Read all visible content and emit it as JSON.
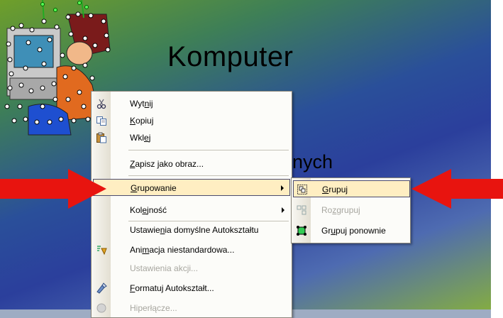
{
  "slide": {
    "title": "Komputer",
    "subtitle_fragment": "nych"
  },
  "context_menu": {
    "items": [
      {
        "pre": "Wyt",
        "ul": "n",
        "post": "ij",
        "icon": "scissors-icon",
        "enabled": true
      },
      {
        "pre": "",
        "ul": "K",
        "post": "opiuj",
        "icon": "copy-icon",
        "enabled": true
      },
      {
        "pre": "Wkl",
        "ul": "e",
        "post": "j",
        "icon": "paste-icon",
        "enabled": true
      },
      {
        "pre": "",
        "ul": "Z",
        "post": "apisz jako obraz...",
        "icon": "",
        "enabled": true
      },
      {
        "pre": "",
        "ul": "G",
        "post": "rupowanie",
        "icon": "",
        "enabled": true,
        "submenu": true,
        "highlighted": true
      },
      {
        "pre": "Kol",
        "ul": "e",
        "post": "jność",
        "icon": "",
        "enabled": true,
        "submenu": true
      },
      {
        "pre": "Ustawie",
        "ul": "n",
        "post": "ia domyślne Autokształtu",
        "icon": "",
        "enabled": true
      },
      {
        "pre": "Ani",
        "ul": "m",
        "post": "acja niestandardowa...",
        "icon": "animation-icon",
        "enabled": true
      },
      {
        "pre": "Ustawienia akcji...",
        "ul": "",
        "post": "",
        "icon": "",
        "enabled": false
      },
      {
        "pre": "",
        "ul": "F",
        "post": "ormatuj Autokształt...",
        "icon": "format-icon",
        "enabled": true
      },
      {
        "pre": "Hiperłącze...",
        "ul": "",
        "post": "",
        "icon": "hyperlink-icon",
        "enabled": false
      }
    ]
  },
  "submenu": {
    "items": [
      {
        "pre": "",
        "ul": "G",
        "post": "rupuj",
        "icon": "group-icon",
        "enabled": true,
        "highlighted": true
      },
      {
        "pre": "Ro",
        "ul": "z",
        "post": "grupuj",
        "icon": "ungroup-icon",
        "enabled": false
      },
      {
        "pre": "Gr",
        "ul": "u",
        "post": "puj ponownie",
        "icon": "regroup-icon",
        "enabled": true
      }
    ]
  },
  "colors": {
    "highlight": "#ffeec2",
    "arrow": "#e8140f",
    "menu_bg": "#fcfcf9"
  }
}
